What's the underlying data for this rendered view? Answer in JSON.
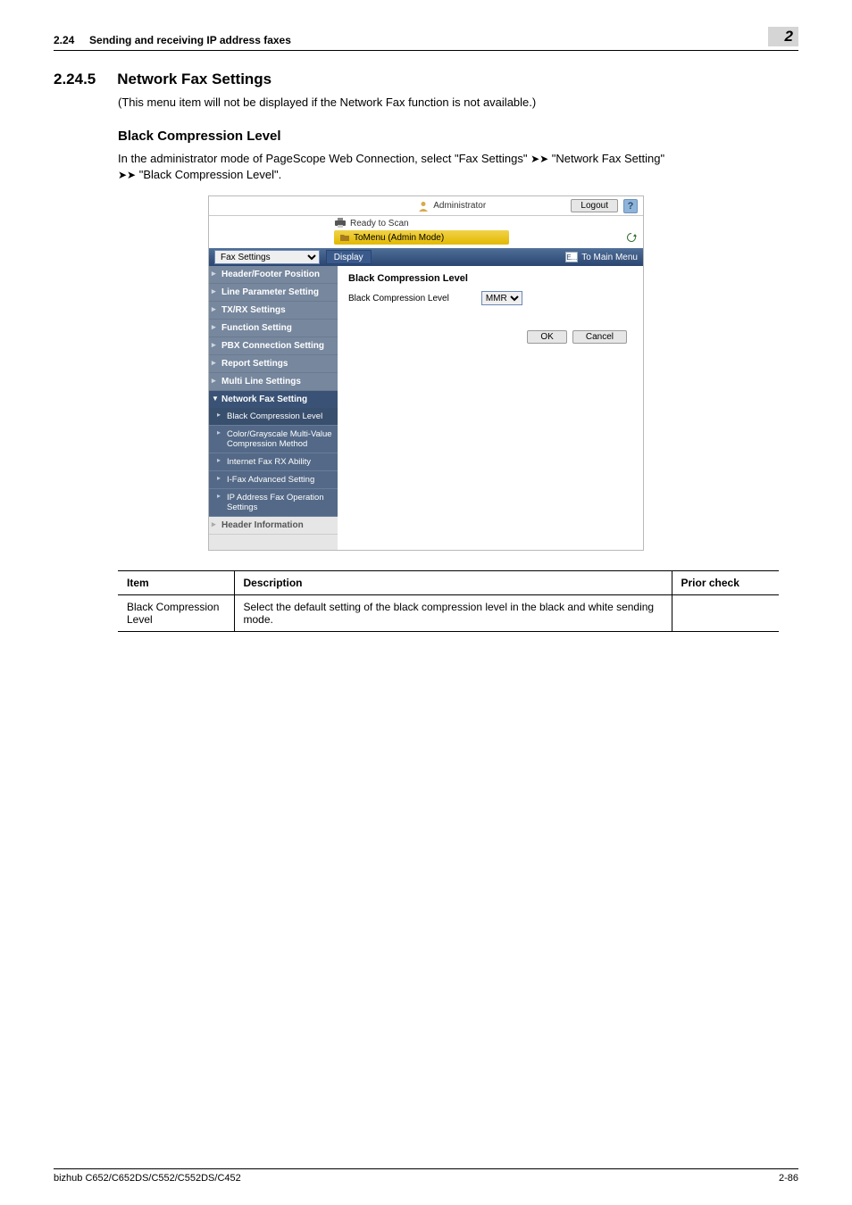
{
  "header": {
    "section_number_top": "2.24",
    "section_title_top": "Sending and receiving IP address faxes",
    "badge": "2"
  },
  "heading": {
    "number": "2.24.5",
    "title": "Network Fax Settings",
    "intro": "(This menu item will not be displayed if the Network Fax function is not available.)",
    "sub_title": "Black Compression Level",
    "body_a": "In the administrator mode of PageScope Web Connection, select \"Fax Settings\" ",
    "body_b": " \"Network Fax Setting\" ",
    "body_c": " \"Black Compression Level\"."
  },
  "shot": {
    "admin_label": "Administrator",
    "logout": "Logout",
    "help": "?",
    "ready": "Ready to Scan",
    "menu_mode": "ToMenu (Admin Mode)",
    "fax_settings_option": "Fax Settings",
    "display": "Display",
    "to_main_e": "E...",
    "to_main": "To Main Menu",
    "sidebar": {
      "items": [
        "Header/Footer Position",
        "Line Parameter Setting",
        "TX/RX Settings",
        "Function Setting",
        "PBX Connection Setting",
        "Report Settings",
        "Multi Line Settings"
      ],
      "section": "Network Fax Setting",
      "subs": [
        "Black Compression Level",
        "Color/Grayscale Multi-Value Compression Method",
        "Internet Fax RX Ability",
        "I-Fax Advanced Setting",
        "IP Address Fax Operation Settings"
      ],
      "bottom": "Header Information"
    },
    "pane": {
      "title": "Black Compression Level",
      "field_label": "Black Compression Level",
      "field_value": "MMR",
      "ok": "OK",
      "cancel": "Cancel"
    }
  },
  "table": {
    "headers": [
      "Item",
      "Description",
      "Prior check"
    ],
    "row": {
      "item": "Black Compression Level",
      "desc": "Select the default setting of the black compression level in the black and white sending mode.",
      "prior": ""
    }
  },
  "footer": {
    "model": "bizhub C652/C652DS/C552/C552DS/C452",
    "page_no": "2-86"
  },
  "glyphs": {
    "arrow": "➤➤"
  }
}
